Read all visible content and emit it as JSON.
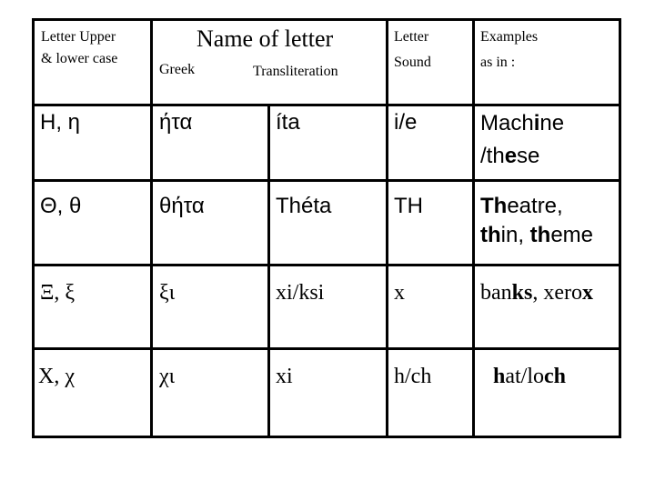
{
  "header": {
    "letter_case": [
      "Letter Upper",
      "& lower case"
    ],
    "name_of_letter": "Name of letter",
    "greek": "Greek",
    "transliteration": "Transliteration",
    "letter_sound": [
      "Letter",
      "Sound"
    ],
    "examples": [
      "Examples",
      "as in :"
    ]
  },
  "rows": [
    {
      "letter": "Η, η",
      "greek_name": "ήτα",
      "transliteration": "íta",
      "sound": "i/e",
      "example_line1": [
        {
          "t": "Mach",
          "b": false
        },
        {
          "t": "i",
          "b": true
        },
        {
          "t": "ne",
          "b": false
        }
      ],
      "example_line2": [
        {
          "t": "/th",
          "b": false
        },
        {
          "t": "e",
          "b": true
        },
        {
          "t": "se",
          "b": false
        }
      ]
    },
    {
      "letter": "Θ, θ",
      "greek_name": "θήτα",
      "transliteration": "Théta",
      "sound": "TH",
      "example_line1": [
        {
          "t": "Th",
          "b": true
        },
        {
          "t": "eatre,",
          "b": false
        }
      ],
      "example_line2": [
        {
          "t": "th",
          "b": true
        },
        {
          "t": "in, ",
          "b": false
        },
        {
          "t": "th",
          "b": true
        },
        {
          "t": "eme",
          "b": false
        }
      ]
    },
    {
      "letter": "Ξ, ξ",
      "greek_name": "ξι",
      "transliteration": "xi/ksi",
      "sound": "x",
      "example_line1": [
        {
          "t": "ban",
          "b": false
        },
        {
          "t": "ks",
          "b": true
        },
        {
          "t": ", xero",
          "b": false
        },
        {
          "t": "x",
          "b": true
        }
      ],
      "example_line2": []
    },
    {
      "letter": "Χ, χ",
      "greek_name": "χι",
      "transliteration": "xi",
      "sound": "h/ch",
      "example_line1": [
        {
          "t": "h",
          "b": true
        },
        {
          "t": "at/lo",
          "b": false
        },
        {
          "t": "ch",
          "b": true
        }
      ],
      "example_line2": []
    }
  ]
}
